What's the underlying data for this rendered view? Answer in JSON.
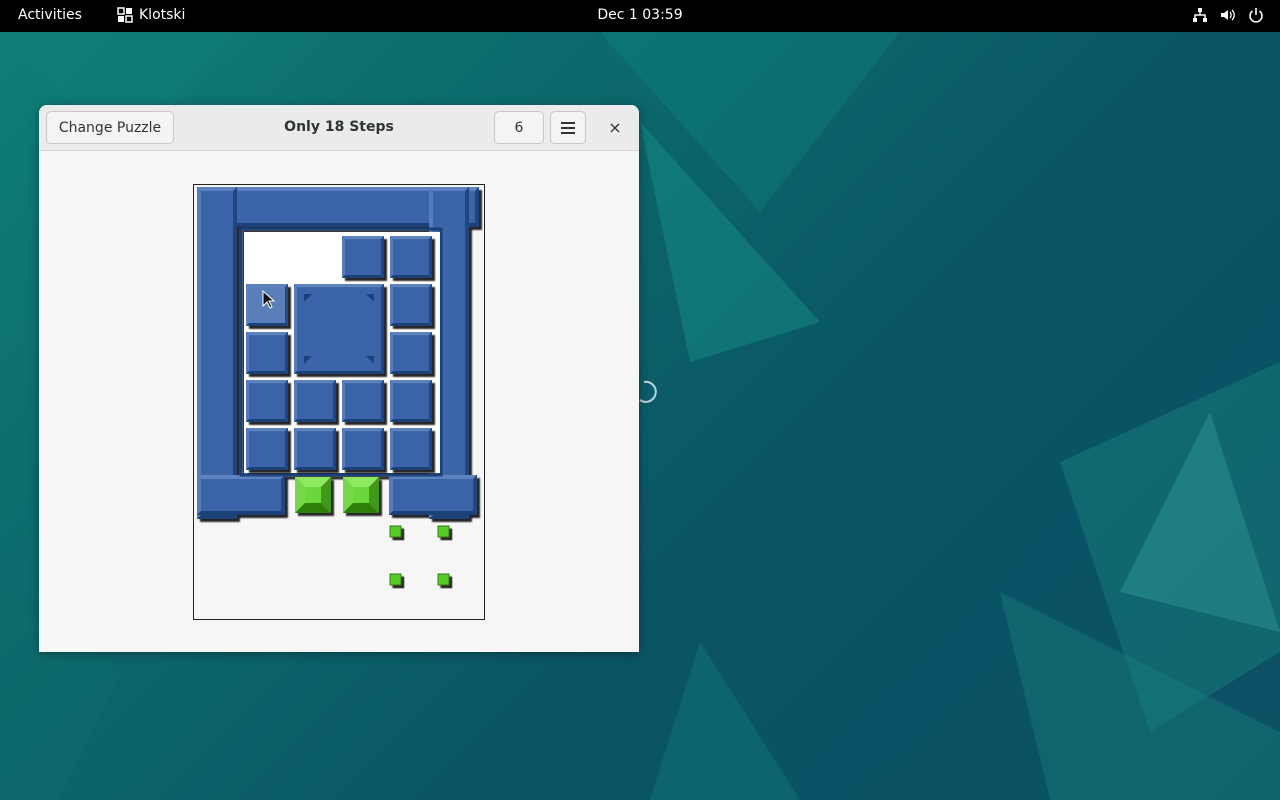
{
  "topbar": {
    "activities": "Activities",
    "app_name": "Klotski",
    "clock": "Dec 1  03:59",
    "tray_icons": [
      "network-icon",
      "volume-icon",
      "power-icon"
    ]
  },
  "window": {
    "change_puzzle_label": "Change Puzzle",
    "title": "Only 18 Steps",
    "moves": "6",
    "menu_icon": "hamburger-menu-icon",
    "close_label": "×"
  },
  "puzzle": {
    "colors": {
      "blue": "#3a65a8",
      "blue_light": "#5b82c0",
      "blue_dark": "#1d3f78",
      "green": "#55cc22",
      "green_dark": "#2f8010",
      "selected": "#5a7fb8"
    },
    "grid": {
      "cols": 6,
      "rows": 9
    },
    "walls": "U-shaped wall frame with opening at bottom",
    "pieces": [
      {
        "col": 3,
        "row": 1,
        "w": 1,
        "h": 1,
        "kind": "small"
      },
      {
        "col": 4,
        "row": 1,
        "w": 1,
        "h": 1,
        "kind": "small"
      },
      {
        "col": 1,
        "row": 2,
        "w": 1,
        "h": 1,
        "kind": "small",
        "selected": true
      },
      {
        "col": 2,
        "row": 2,
        "w": 2,
        "h": 2,
        "kind": "big"
      },
      {
        "col": 4,
        "row": 2,
        "w": 1,
        "h": 1,
        "kind": "small"
      },
      {
        "col": 1,
        "row": 3,
        "w": 1,
        "h": 1,
        "kind": "small"
      },
      {
        "col": 4,
        "row": 3,
        "w": 1,
        "h": 1,
        "kind": "small"
      },
      {
        "col": 1,
        "row": 4,
        "w": 1,
        "h": 1,
        "kind": "small"
      },
      {
        "col": 2,
        "row": 4,
        "w": 1,
        "h": 1,
        "kind": "small"
      },
      {
        "col": 3,
        "row": 4,
        "w": 1,
        "h": 1,
        "kind": "small"
      },
      {
        "col": 4,
        "row": 4,
        "w": 1,
        "h": 1,
        "kind": "small"
      },
      {
        "col": 1,
        "row": 5,
        "w": 1,
        "h": 1,
        "kind": "small"
      },
      {
        "col": 2,
        "row": 5,
        "w": 1,
        "h": 1,
        "kind": "small"
      },
      {
        "col": 3,
        "row": 5,
        "w": 1,
        "h": 1,
        "kind": "small"
      },
      {
        "col": 4,
        "row": 5,
        "w": 1,
        "h": 1,
        "kind": "small"
      }
    ],
    "goal_tiles": [
      {
        "col": 2,
        "row": 6
      },
      {
        "col": 3,
        "row": 6
      }
    ],
    "target_markers": [
      {
        "col": 4,
        "row": 7
      },
      {
        "col": 5,
        "row": 7
      },
      {
        "col": 4,
        "row": 8
      },
      {
        "col": 5,
        "row": 8
      }
    ]
  }
}
